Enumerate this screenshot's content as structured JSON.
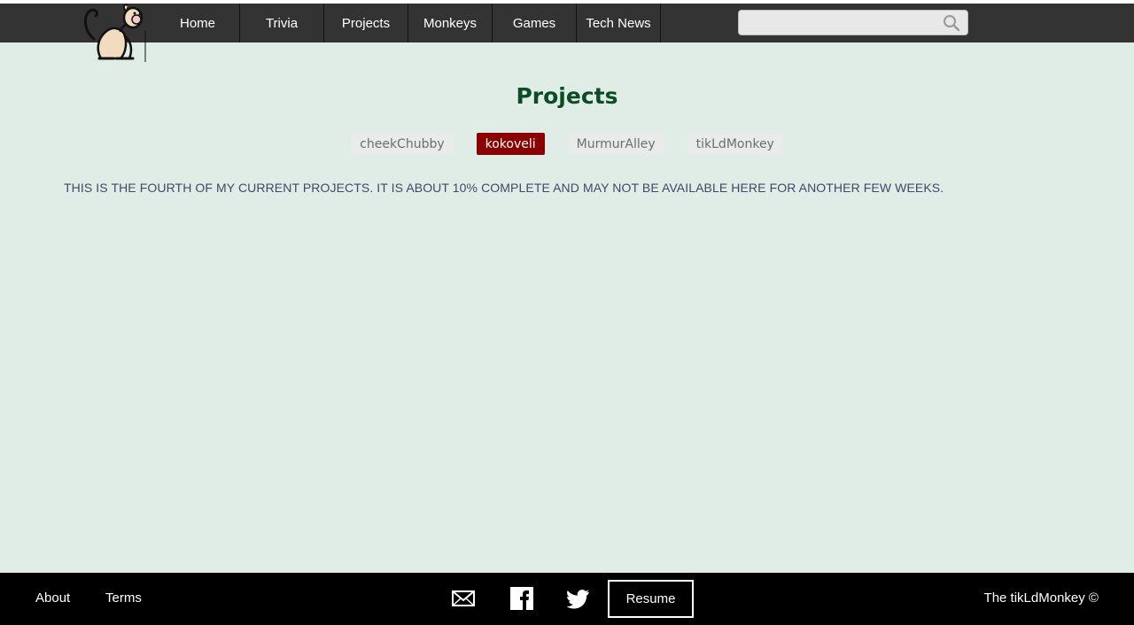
{
  "nav": {
    "items": [
      "Home",
      "Trivia",
      "Projects",
      "Monkeys",
      "Games",
      "Tech News"
    ],
    "search_placeholder": "",
    "search_icon": "magnifier-icon"
  },
  "logo": {
    "icon": "monkey-logo"
  },
  "main": {
    "title": "Projects",
    "tabs": [
      {
        "label": "cheekChubby",
        "active": false
      },
      {
        "label": "kokoveli",
        "active": true
      },
      {
        "label": "MurmurAlley",
        "active": false
      },
      {
        "label": "tikLdMonkey",
        "active": false
      }
    ],
    "description": "This is the fourth of my current projects. It is about 10% complete and may not be available here for another few weeks."
  },
  "footer": {
    "about": "About",
    "terms": "Terms",
    "icons": [
      "mail-icon",
      "facebook-icon",
      "twitter-icon"
    ],
    "resume": "Resume",
    "copyright": "The tikLdMonkey ©"
  },
  "colors": {
    "nav_bg": "#333333",
    "page_bg": "#e0ece6",
    "title": "#0b4d26",
    "active_tab": "#8b0000",
    "footer_bg": "#000000"
  }
}
